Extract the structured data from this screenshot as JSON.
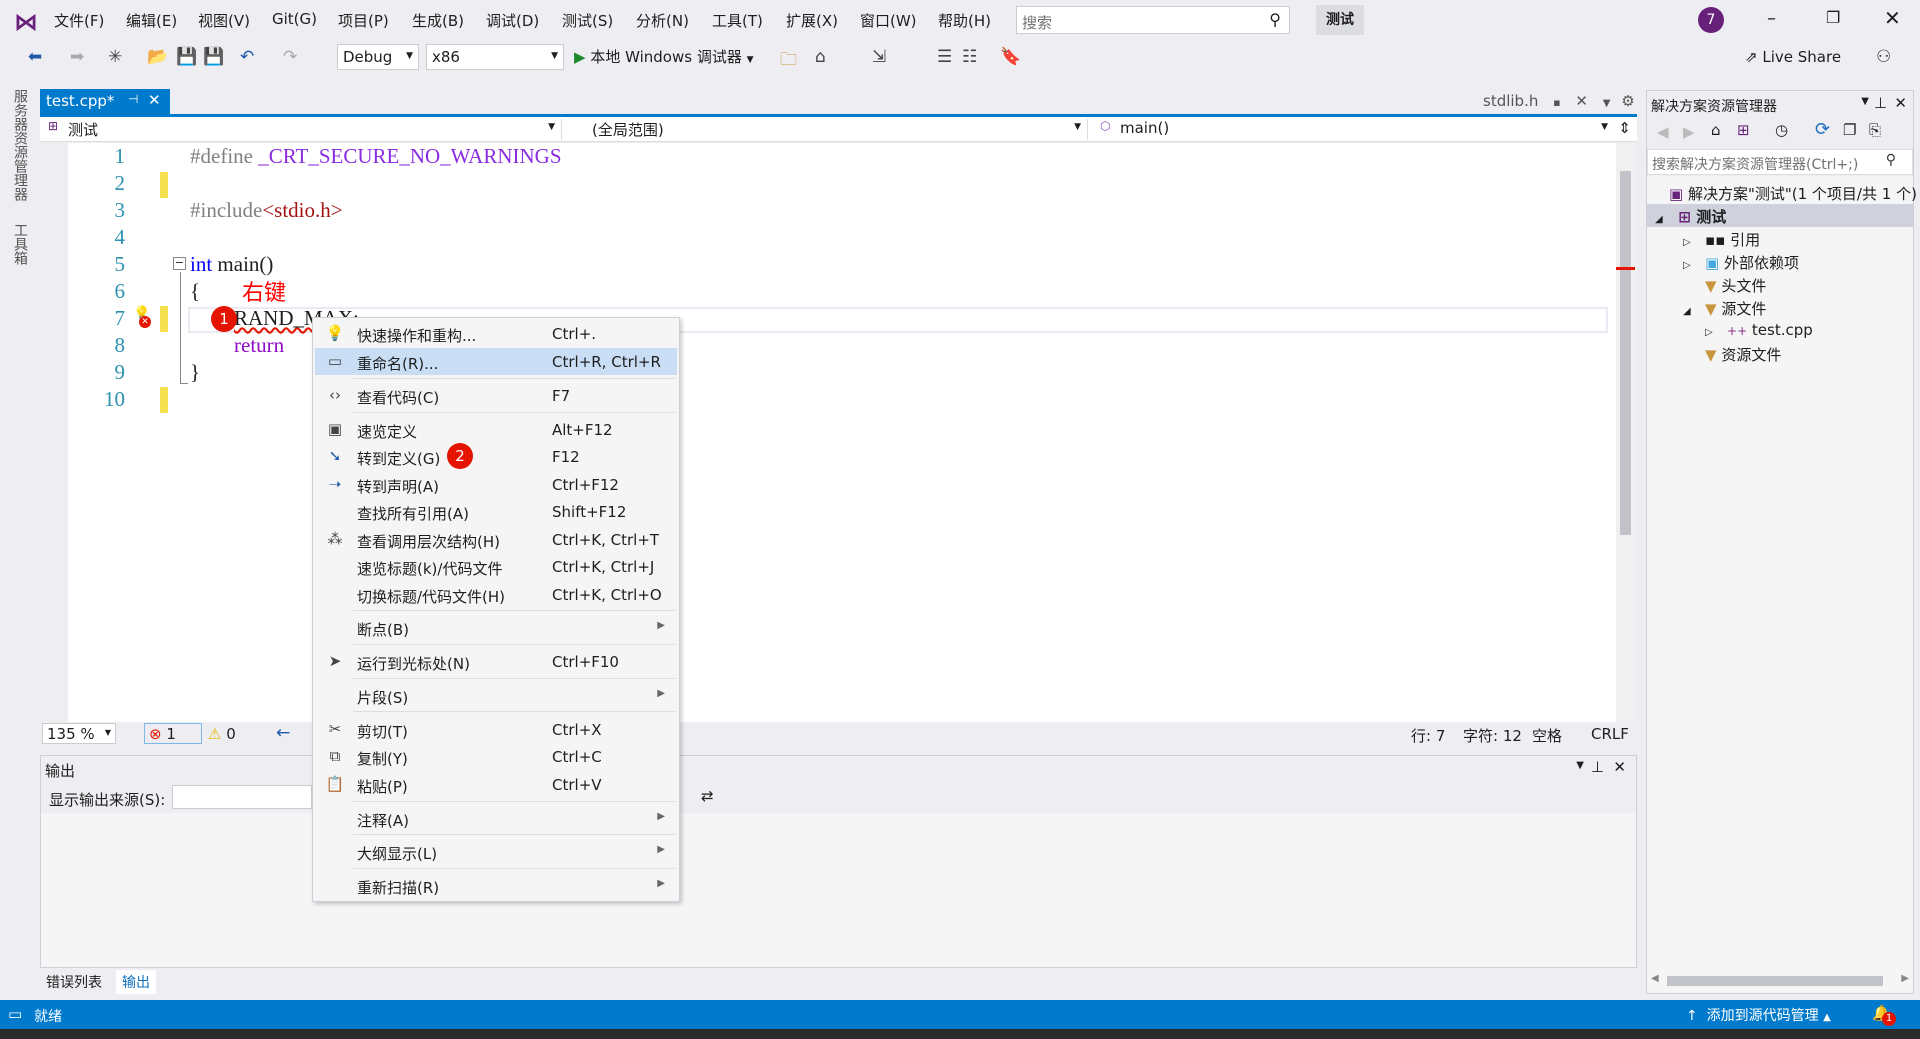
{
  "menu": [
    "文件(F)",
    "编辑(E)",
    "视图(V)",
    "Git(G)",
    "项目(P)",
    "生成(B)",
    "调试(D)",
    "测试(S)",
    "分析(N)",
    "工具(T)",
    "扩展(X)",
    "窗口(W)",
    "帮助(H)"
  ],
  "search": {
    "placeholder": "搜索"
  },
  "solution_name_button": "测试",
  "avatar_badge": "7",
  "toolbar": {
    "config": "Debug",
    "platform": "x86",
    "run_label": "本地 Windows 调试器",
    "live_share": "Live Share"
  },
  "left_strip": [
    "服务器资源管理器",
    "工具箱"
  ],
  "editor": {
    "tab": "test.cpp*",
    "other_tab": "stdlib.h",
    "nav": {
      "project": "测试",
      "scope": "(全局范围)",
      "member": "main()"
    },
    "line_numbers": [
      "1",
      "2",
      "3",
      "4",
      "5",
      "6",
      "7",
      "8",
      "9",
      "10"
    ],
    "lines": {
      "l1a": "#define ",
      "l1b": "_CRT_SECURE_NO_WARNINGS",
      "l3a": "#include",
      "l3b": "<stdio.h>",
      "l5a": "int",
      "l5b": " main()",
      "l6": "{",
      "l7": "RAND_MAX;",
      "l8": "return",
      "l9": "}"
    },
    "annotation": "右键",
    "step1": "1",
    "step2": "2"
  },
  "status_row": {
    "zoom": "135 %",
    "errors": "1",
    "warnings": "0",
    "line": "行: 7",
    "char": "字符: 12",
    "spaces": "空格",
    "eol": "CRLF"
  },
  "context_menu": [
    {
      "label": "快速操作和重构...",
      "shortcut": "Ctrl+.",
      "icon": "lightbulb-icon"
    },
    {
      "label": "重命名(R)...",
      "shortcut": "Ctrl+R, Ctrl+R",
      "icon": "rename-icon",
      "highlighted": true
    },
    {
      "label": "查看代码(C)",
      "shortcut": "F7",
      "icon": "code-icon"
    },
    {
      "label": "速览定义",
      "shortcut": "Alt+F12",
      "icon": "peek-icon"
    },
    {
      "label": "转到定义(G)",
      "shortcut": "F12",
      "icon": "goto-definition-icon"
    },
    {
      "label": "转到声明(A)",
      "shortcut": "Ctrl+F12",
      "icon": "goto-declaration-icon"
    },
    {
      "label": "查找所有引用(A)",
      "shortcut": "Shift+F12",
      "icon": ""
    },
    {
      "label": "查看调用层次结构(H)",
      "shortcut": "Ctrl+K, Ctrl+T",
      "icon": "call-hierarchy-icon"
    },
    {
      "label": "速览标题(k)/代码文件",
      "shortcut": "Ctrl+K, Ctrl+J",
      "icon": ""
    },
    {
      "label": "切换标题/代码文件(H)",
      "shortcut": "Ctrl+K, Ctrl+O",
      "icon": ""
    },
    {
      "label": "断点(B)",
      "shortcut": "",
      "icon": "",
      "submenu": true
    },
    {
      "label": "运行到光标处(N)",
      "shortcut": "Ctrl+F10",
      "icon": "cursor-icon"
    },
    {
      "label": "片段(S)",
      "shortcut": "",
      "icon": "",
      "submenu": true
    },
    {
      "label": "剪切(T)",
      "shortcut": "Ctrl+X",
      "icon": "scissors-icon"
    },
    {
      "label": "复制(Y)",
      "shortcut": "Ctrl+C",
      "icon": "copy-icon"
    },
    {
      "label": "粘贴(P)",
      "shortcut": "Ctrl+V",
      "icon": "paste-icon"
    },
    {
      "label": "注释(A)",
      "shortcut": "",
      "icon": "",
      "submenu": true
    },
    {
      "label": "大纲显示(L)",
      "shortcut": "",
      "icon": "",
      "submenu": true
    },
    {
      "label": "重新扫描(R)",
      "shortcut": "",
      "icon": "",
      "submenu": true
    }
  ],
  "output": {
    "title": "输出",
    "source_label": "显示输出来源(S):"
  },
  "bottom_tabs": [
    "错误列表",
    "输出"
  ],
  "solution_explorer": {
    "title": "解决方案资源管理器",
    "search_placeholder": "搜索解决方案资源管理器(Ctrl+;)",
    "solution": "解决方案\"测试\"(1 个项目/共 1 个)",
    "project": "测试",
    "items": [
      "引用",
      "外部依赖项",
      "头文件",
      "源文件",
      "test.cpp",
      "资源文件"
    ]
  },
  "statusbar": {
    "ready": "就绪",
    "source_control": "添加到源代码管理",
    "notifications": "1"
  },
  "colors": {
    "accent": "#007acc",
    "statusbar": "#007acc",
    "error": "#e51400",
    "highlight": "#c9def5"
  }
}
